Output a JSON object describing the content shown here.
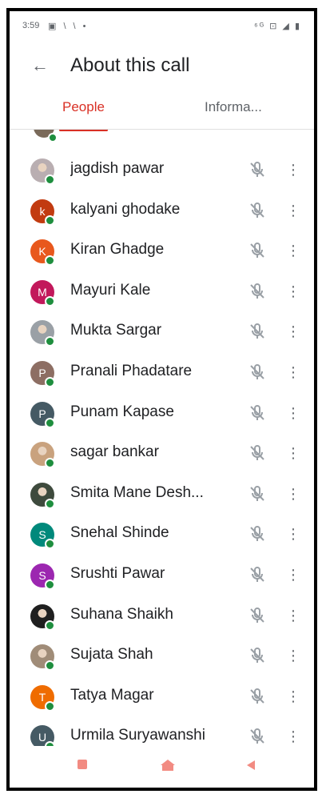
{
  "status_bar": {
    "time": "3:59",
    "left_icons": "▣ \\ \\ •",
    "right_icons": "⁶ᴳ ⊡ ◢ ▮"
  },
  "header": {
    "title": "About this call"
  },
  "tabs": [
    {
      "label": "People",
      "active": true
    },
    {
      "label": "Informa...",
      "active": false
    }
  ],
  "people": [
    {
      "name": "jagdish pawar",
      "initial": "",
      "avatar_color": "#b9aeb1",
      "photo": true
    },
    {
      "name": "kalyani ghodake",
      "initial": "k",
      "avatar_color": "#c23b10",
      "photo": false
    },
    {
      "name": "Kiran Ghadge",
      "initial": "K",
      "avatar_color": "#e8581d",
      "photo": false
    },
    {
      "name": "Mayuri Kale",
      "initial": "M",
      "avatar_color": "#c2185b",
      "photo": false
    },
    {
      "name": "Mukta Sargar",
      "initial": "",
      "avatar_color": "#9aa0a6",
      "photo": true
    },
    {
      "name": "Pranali Phadatare",
      "initial": "P",
      "avatar_color": "#8d6e63",
      "photo": false
    },
    {
      "name": "Punam Kapase",
      "initial": "P",
      "avatar_color": "#455a64",
      "photo": false
    },
    {
      "name": "sagar bankar",
      "initial": "",
      "avatar_color": "#c9a27e",
      "photo": true
    },
    {
      "name": "Smita Mane Desh...",
      "initial": "",
      "avatar_color": "#3e4a3d",
      "photo": true
    },
    {
      "name": "Snehal Shinde",
      "initial": "S",
      "avatar_color": "#00897b",
      "photo": false
    },
    {
      "name": "Srushti Pawar",
      "initial": "S",
      "avatar_color": "#9c27b0",
      "photo": false
    },
    {
      "name": "Suhana Shaikh",
      "initial": "",
      "avatar_color": "#1f1f1f",
      "photo": true
    },
    {
      "name": "Sujata Shah",
      "initial": "",
      "avatar_color": "#a08c78",
      "photo": true
    },
    {
      "name": "Tatya Magar",
      "initial": "T",
      "avatar_color": "#ef6c00",
      "photo": false
    },
    {
      "name": "Urmila Suryawanshi",
      "initial": "U",
      "avatar_color": "#455a64",
      "photo": false
    }
  ],
  "colors": {
    "accent": "#d93025",
    "presence": "#1e8e3e"
  }
}
